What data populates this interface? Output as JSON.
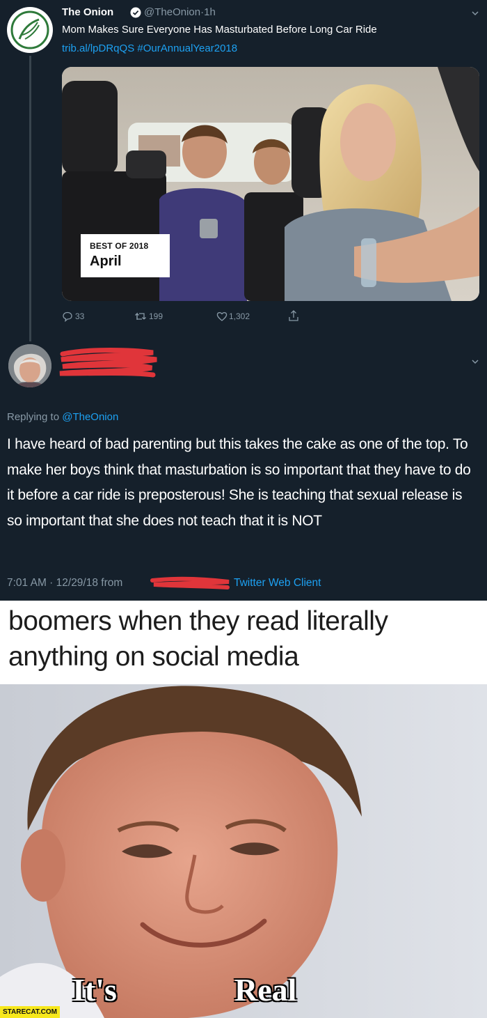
{
  "tweet": {
    "author_name": "The Onion",
    "handle": "@TheOnion",
    "separator": "·",
    "age": "1h",
    "text": "Mom Makes Sure Everyone Has Masturbated Before Long Car Ride",
    "link": "trib.al/lpDRqQS #OurAnnualYear2018",
    "badge_small": "BEST OF 2018",
    "badge_big": "April",
    "reply_count": "33",
    "retweet_count": "199",
    "like_count": "1,302",
    "avatar_icon": "onion-logo-icon"
  },
  "reply": {
    "replying_prefix": "Replying to ",
    "replying_handle": "@TheOnion",
    "body": "I have heard of bad parenting but this takes the cake as one of the top.  To make her boys think that masturbation is so important that they have to do it before a car ride is preposterous! She is teaching that sexual release is so important that she does not teach that it is NOT",
    "timestamp": "7:01 AM · 12/29/18 from",
    "client": "Twitter Web Client"
  },
  "meme": {
    "caption": "boomers when they read literally anything on social media",
    "overlay_left": "It's",
    "overlay_right": "Real",
    "watermark": "STARECAT.COM"
  },
  "colors": {
    "background": "#15202b",
    "secondary_text": "#8899a6",
    "link": "#1da1f2",
    "redaction": "#e0353a",
    "watermark_bg": "#f7e81c"
  }
}
